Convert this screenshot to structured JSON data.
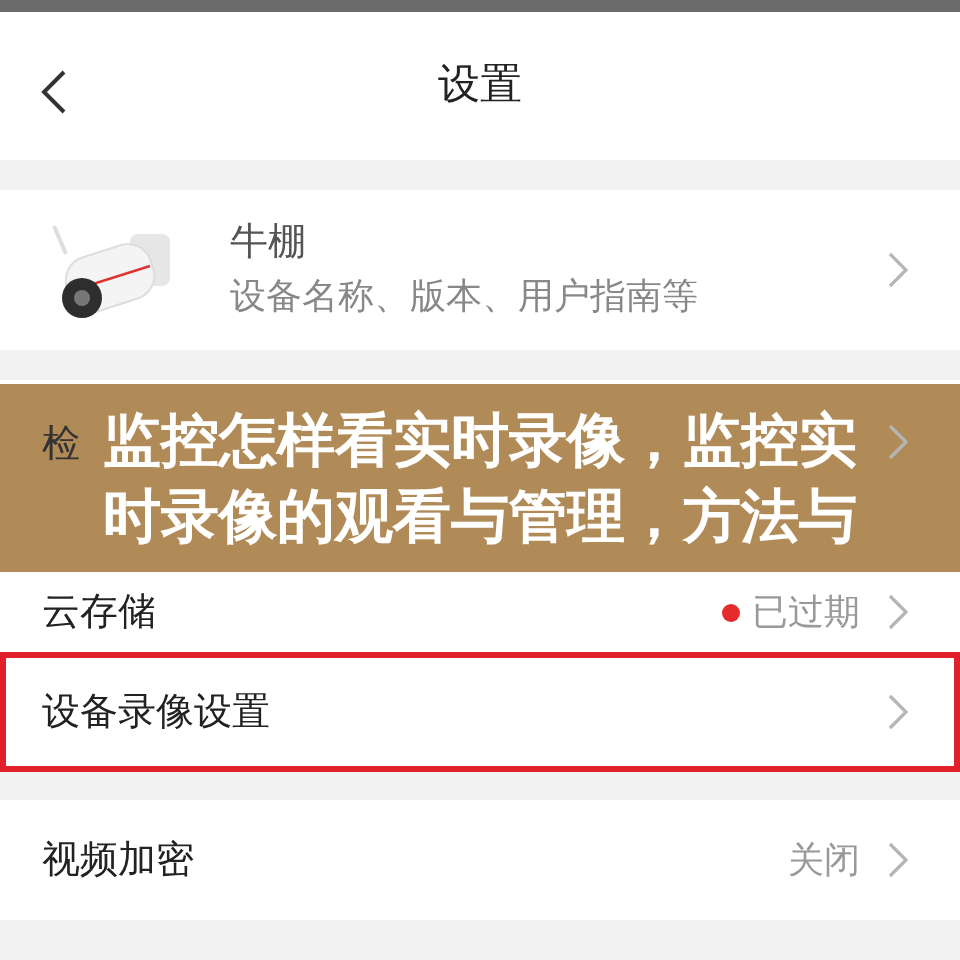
{
  "header": {
    "title": "设置"
  },
  "device": {
    "name": "牛棚",
    "subtitle": "设备名称、版本、用户指南等"
  },
  "rows": [
    {
      "label": "检"
    },
    {
      "label": "云存储",
      "value": "已过期",
      "color": "#e52b2b",
      "highlighted": false
    },
    {
      "label": "设备录像设置",
      "highlighted": true
    },
    {
      "label": "视频加密",
      "value": "关闭",
      "highlighted": false
    }
  ],
  "banner": {
    "lines": [
      "监控怎样看实时录像，监控实",
      "时录像的观看与管理，方法与"
    ]
  }
}
